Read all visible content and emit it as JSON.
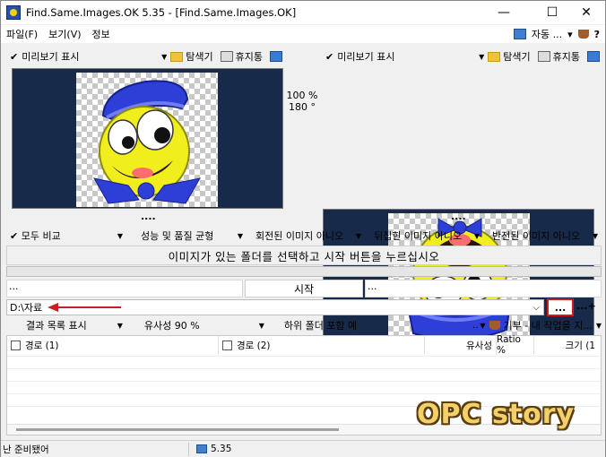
{
  "window": {
    "title": "Find.Same.Images.OK 5.35 - [Find.Same.Images.OK]",
    "minimize": "—",
    "maximize": "☐",
    "close": "✕"
  },
  "menu": {
    "items": [
      "파일(F)",
      "보기(V)",
      "정보"
    ],
    "right_label": "자동 ...",
    "right_arrow": "▾"
  },
  "left_preview": {
    "check": "✔",
    "label": "미리보기 표시",
    "explorer": "탐색기",
    "trash": "휴지통",
    "dots": "...."
  },
  "right_preview": {
    "check": "✔",
    "label": "미리보기 표시",
    "explorer": "탐색기",
    "trash": "휴지통",
    "dots": "...."
  },
  "compare_info": {
    "percent": "100 %",
    "angle": "180 °"
  },
  "options": [
    {
      "label": "✔ 모두 비교",
      "arrow": "▼"
    },
    {
      "label": "성능 및 품질 균형",
      "arrow": "▼"
    },
    {
      "label": "회전된 이미지 아니오",
      "arrow": "▼"
    },
    {
      "label": "뒤집힌 이미지 아니오",
      "arrow": "▼"
    },
    {
      "label": "반전된 이미지 아니오",
      "arrow": "▼"
    }
  ],
  "instruction": "이미지가 있는 폴더를 선택하고 시작 버튼을 누르십시오",
  "start": {
    "left_dots": "...",
    "label": "시작",
    "right_dots": "..."
  },
  "path": {
    "value": "D:\\자료",
    "dropdown": "⌵",
    "browse": "...",
    "add": "...+"
  },
  "results_bar": {
    "show_list": "결과 목록 표시",
    "similarity": "유사성 90 %",
    "subfolders": "하위 폴더 포함 예",
    "extra": "..",
    "donate": "기부 - 내 작업을 지...",
    "arrow": "▼"
  },
  "table": {
    "columns": [
      "경로 (1)",
      "경로 (2)",
      "유사성",
      "Ratio %",
      "크기 (1"
    ]
  },
  "status": {
    "left": "난 준비됐어",
    "version": "5.35"
  },
  "watermark": "OPC story",
  "colors": {
    "preview_bg": "#182a4a",
    "highlight_red": "#d21a1a",
    "arrow_red": "#c62020"
  }
}
